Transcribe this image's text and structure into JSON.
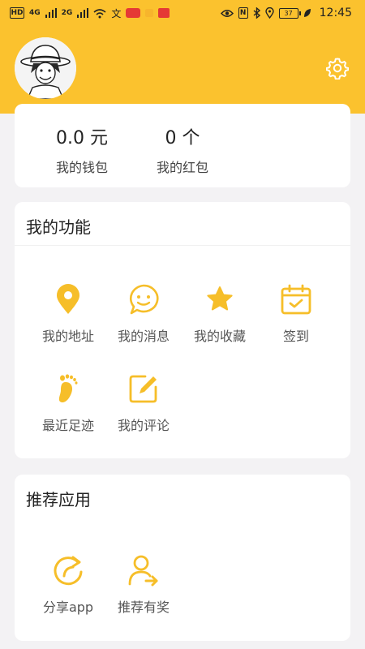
{
  "status_bar": {
    "left_icons": [
      "hd-icon",
      "4g-signal-icon",
      "2g-signal-icon",
      "wifi-icon",
      "nfc-app-icon",
      "app-notification-icon",
      "gift-icon",
      "news-app-icon"
    ],
    "right_icons": [
      "eye-icon",
      "nfc-icon",
      "bluetooth-icon",
      "location-icon",
      "battery-icon",
      "leaf-icon"
    ],
    "signal_label_1": "4G",
    "signal_label_2": "2G",
    "battery": "37",
    "time": "12:45"
  },
  "profile": {
    "avatar": "avatar-illustration",
    "settings_icon": "gear-icon"
  },
  "wallet": {
    "balance_value": "0.0 元",
    "balance_label": "我的钱包",
    "redpacket_value": "0 个",
    "redpacket_label": "我的红包"
  },
  "functions": {
    "title": "我的功能",
    "items": [
      {
        "label": "我的地址",
        "icon": "location-pin-icon"
      },
      {
        "label": "我的消息",
        "icon": "message-bubble-icon"
      },
      {
        "label": "我的收藏",
        "icon": "star-icon"
      },
      {
        "label": "签到",
        "icon": "calendar-check-icon"
      },
      {
        "label": "最近足迹",
        "icon": "footprint-icon"
      },
      {
        "label": "我的评论",
        "icon": "edit-icon"
      }
    ]
  },
  "recommended": {
    "title": "推荐应用",
    "items": [
      {
        "label": "分享app",
        "icon": "share-icon"
      },
      {
        "label": "推荐有奖",
        "icon": "refer-user-icon"
      }
    ]
  },
  "colors": {
    "accent": "#fbc22e",
    "icon": "#f6be29",
    "background": "#f3f2f4",
    "card": "#ffffff"
  }
}
